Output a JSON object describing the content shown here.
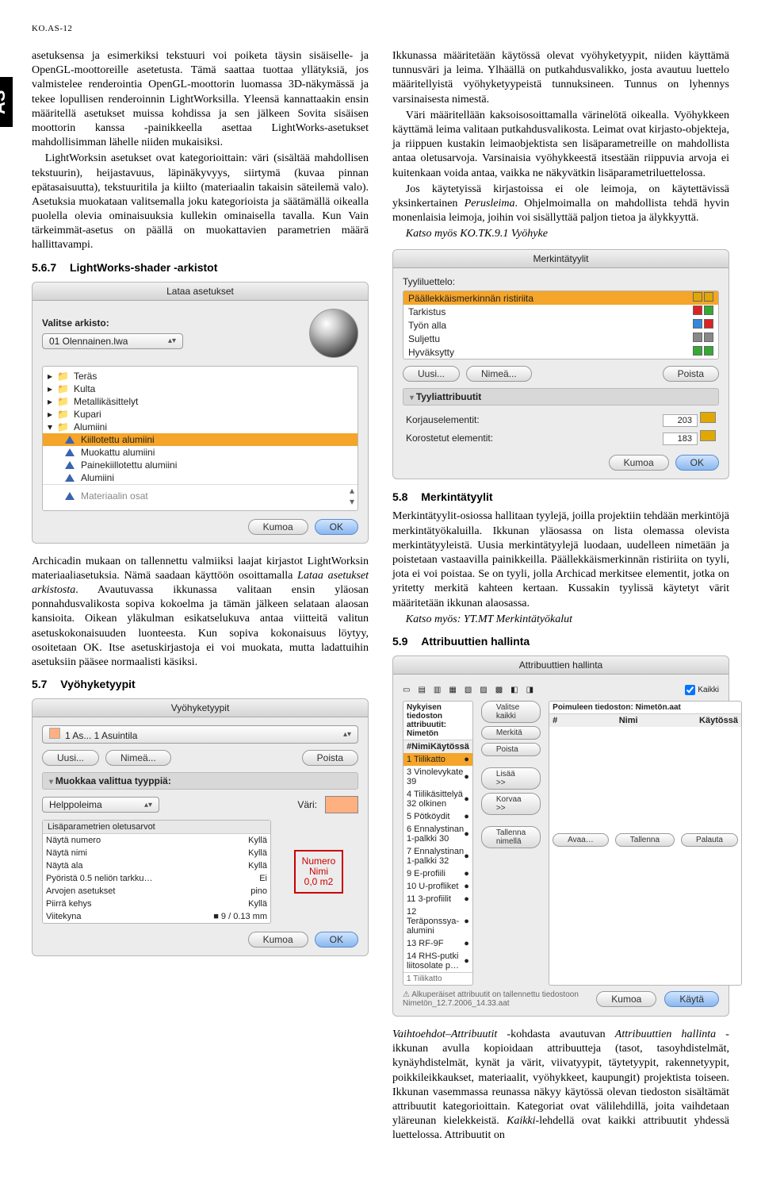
{
  "header": {
    "code": "KO.AS-12"
  },
  "sidetab": "AS",
  "col1": {
    "p1": "asetuksensa ja esimerkiksi tekstuuri voi poiketa täysin sisäiselle- ja OpenGL-moottoreille asetetusta. Tämä saattaa tuottaa yllätyksiä, jos valmistelee renderointia OpenGL-moottorin luomassa 3D-näkymässä ja tekee lopullisen renderoinnin LightWorksilla. Yleensä kannattaakin ensin määritellä asetukset muissa kohdissa ja sen jälkeen Sovita sisäisen moottorin kanssa -painikkeella asettaa LightWorks-asetukset mahdollisimman lähelle niiden mukaisiksi.",
    "p2": "LightWorksin asetukset ovat kategorioittain: väri (sisältää mahdollisen tekstuurin), heijastavuus, läpinäkyvyys, siirtymä (kuvaa pinnan epätasaisuutta), tekstuuritila ja kiilto (materiaalin takaisin säteilemä valo). Asetuksia muokataan valitsemalla joku kategorioista ja säätämällä oikealla puolella olevia ominaisuuksia kullekin ominaisella tavalla. Kun Vain tärkeimmät-asetus on päällä on muokattavien parametrien määrä hallittavampi.",
    "sect567_num": "5.6.7",
    "sect567_title": "LightWorks-shader -arkistot",
    "dlg1": {
      "title": "Lataa asetukset",
      "label": "Valitse arkisto:",
      "select_value": "01 Olennainen.lwa",
      "folders": [
        "Teräs",
        "Kulta",
        "Metallikäsittelyt",
        "Kupari",
        "Alumiini"
      ],
      "items": [
        "Kiillotettu alumiini",
        "Muokattu alumiini",
        "Painekiillotettu alumiini",
        "Alumiini"
      ],
      "cutoff": "Materiaalin osat",
      "cancel": "Kumoa",
      "ok": "OK"
    },
    "p3a": "Archicadin mukaan on tallennettu valmiiksi laajat kirjastot LightWorksin materiaaliasetuksia. Nämä saadaan käyttöön osoittamalla ",
    "p3b": "Lataa asetukset arkistosta",
    "p3c": ". Avautuvassa ikkunassa valitaan ensin yläosan ponnahdusvalikosta sopiva kokoelma ja tämän jälkeen selataan alaosan kansioita. Oikean yläkulman esikatselukuva antaa viitteitä valitun asetuskokonaisuuden luonteesta. Kun sopiva kokonaisuus löytyy, osoitetaan OK. Itse asetuskirjastoja ei voi muokata, mutta ladattuihin asetuksiin pääsee normaalisti käsiksi.",
    "sect57_num": "5.7",
    "sect57_title": "Vyöhyketyypit",
    "dlg2": {
      "title": "Vyöhyketyypit",
      "zone": "1 As... 1 Asuintila",
      "new": "Uusi...",
      "rename": "Nimeä...",
      "delete": "Poista",
      "sub": "Muokkaa valittua tyyppiä:",
      "stamp_sel": "Helppoleima",
      "color_label": "Väri:",
      "params_header": "Lisäparametrien oletusarvot",
      "params": [
        [
          "Näytä numero",
          "Kyllä"
        ],
        [
          "Näytä nimi",
          "Kyllä"
        ],
        [
          "Näytä ala",
          "Kyllä"
        ],
        [
          "Pyöristä 0.5 neliön tarkku…",
          "Ei"
        ],
        [
          "Arvojen asetukset",
          "pino"
        ],
        [
          "Piirrä kehys",
          "Kyllä"
        ],
        [
          "Viitekyna",
          "■ 9 / 0.13 mm"
        ]
      ],
      "stamp_box": "Numero\nNimi\n0,0 m2",
      "cancel": "Kumoa",
      "ok": "OK"
    }
  },
  "col2": {
    "p1": "Ikkunassa määritetään käytössä olevat vyöhyketyypit, niiden käyttämä tunnusväri ja leima. Ylhäällä on putkahdusvalikko, josta avautuu luettelo määritellyistä vyöhyketyypeistä tunnuksineen. Tunnus on lyhennys varsinaisesta nimestä.",
    "p2": "Väri määritellään kaksoisosoittamalla värinelötä oikealla. Vyöhykkeen käyttämä leima valitaan putkahdusvalikosta. Leimat ovat kirjasto-objekteja, ja riippuen kustakin leimaobjektista sen lisäparametreille on mahdollista antaa oletusarvoja. Varsinaisia vyöhykkeestä itsestään riippuvia arvoja ei kuitenkaan voida antaa, vaikka ne näkyvätkin lisäparametriluettelossa.",
    "p3a": "Jos käytetyissä kirjastoissa ei ole leimoja, on käytettävissä yksinkertainen ",
    "p3b": "Perusleima",
    "p3c": ". Ohjelmoimalla on mahdollista tehdä hyvin monenlaisia leimoja, joihin voi sisällyttää paljon tietoa ja älykkyyttä.",
    "p4": "Katso myös KO.TK.9.1 Vyöhyke",
    "dlg3": {
      "title": "Merkintätyylit",
      "list_label": "Tyyliluettelo:",
      "rows": [
        {
          "name": "Päällekkäismerkinnän ristiriita",
          "c1": "#e0a800",
          "c2": "#e0a800"
        },
        {
          "name": "Tarkistus",
          "c1": "#d22",
          "c2": "#3a3"
        },
        {
          "name": "Työn alla",
          "c1": "#38d",
          "c2": "#d22"
        },
        {
          "name": "Suljettu",
          "c1": "#888",
          "c2": "#888"
        },
        {
          "name": "Hyväksytty",
          "c1": "#3a3",
          "c2": "#3a3"
        }
      ],
      "new": "Uusi...",
      "rename": "Nimeä...",
      "delete": "Poista",
      "attr_header": "Tyyliattribuutit",
      "k1": "Korjauselementit:",
      "v1": "203",
      "k2": "Korostetut elementit:",
      "v2": "183",
      "cancel": "Kumoa",
      "ok": "OK"
    },
    "sect58_num": "5.8",
    "sect58_title": "Merkintätyylit",
    "p5": "Merkintätyylit-osiossa hallitaan tyylejä, joilla projektiin tehdään merkintöjä merkintätyökaluilla. Ikkunan yläosassa on lista olemassa olevista merkintätyyleistä. Uusia merkintätyylejä luodaan, uudelleen nimetään ja poistetaan vastaavilla painikkeilla. Päällekkäismerkinnän ristiriita on tyyli, jota ei voi poistaa. Se on tyyli, jolla Archicad merkitsee elementit, jotka on yritetty merkitä kahteen kertaan. Kussakin tyylissä käytetyt värit määritetään ikkunan alaosassa.",
    "p6": "Katso myös: YT.MT Merkintätyökalut",
    "sect59_num": "5.9",
    "sect59_title": "Attribuuttien hallinta",
    "dlg4": {
      "title": "Attribuuttien hallinta",
      "left_head": "Nykyisen tiedoston attribuutit: Nimetön",
      "right_head": "Poimuleen tiedoston: Nimetön.aat",
      "cols": [
        "#",
        "Nimi",
        "Käytössä"
      ],
      "rows": [
        "1 Tiilikatto",
        "3 Vinolevykate 39",
        "4 Tiilikäsittelyä 32 olkinen",
        "5 Pötköydit",
        "6 Ennalystinan 1-palkki 30",
        "7 Ennalystinan 1-palkki 32",
        "9 E-profiili",
        "10 U-profliket",
        "11 3-profiilit",
        "12 Teräponssya-alumini",
        "13 RF-9F",
        "14 RHS-putki liitosolate p…"
      ],
      "all": "Kaikki",
      "btn_valitse": "Valitse kaikki",
      "btn_merki": "Merkitä",
      "btn_poista": "Poista",
      "btn_lisaa": "Lisää >>",
      "btn_korvaa": "Korvaa >>",
      "btn_tallenna": "Tallenna nimellä",
      "btn_avaa": "Avaa…",
      "btn_tallenna2": "Tallenna",
      "btn_palauta": "Palauta",
      "note": "⚠ Alkuperäiset attribuutit on tallennettu tiedostoon Nimetön_12.7.2006_14.33.aat",
      "cancel": "Kumoa",
      "ok": "Käytä"
    },
    "p7a": "Vaihtoehdot–Attribuutit",
    "p7b": " -kohdasta avautuvan ",
    "p7c": "Attribuuttien hallinta",
    "p7d": " -ikkunan avulla kopioidaan attribuutteja (tasot, tasoyhdistelmät, kynäyhdistelmät, kynät ja värit, viivatyypit, täytetyypit, rakennetyypit, poikkileikkaukset, materiaalit, vyöhykkeet, kaupungit) projektista toiseen. Ikkunan vasemmassa reunassa näkyy käytössä olevan tiedoston sisältämät attribuutit kategorioittain. Kategoriat ovat välilehdillä, joita vaihdetaan yläreunan kielekkeistä. ",
    "p7e": "Kaikki",
    "p7f": "-lehdellä ovat kaikki attribuutit yhdessä luettelossa. Attribuutit on"
  }
}
